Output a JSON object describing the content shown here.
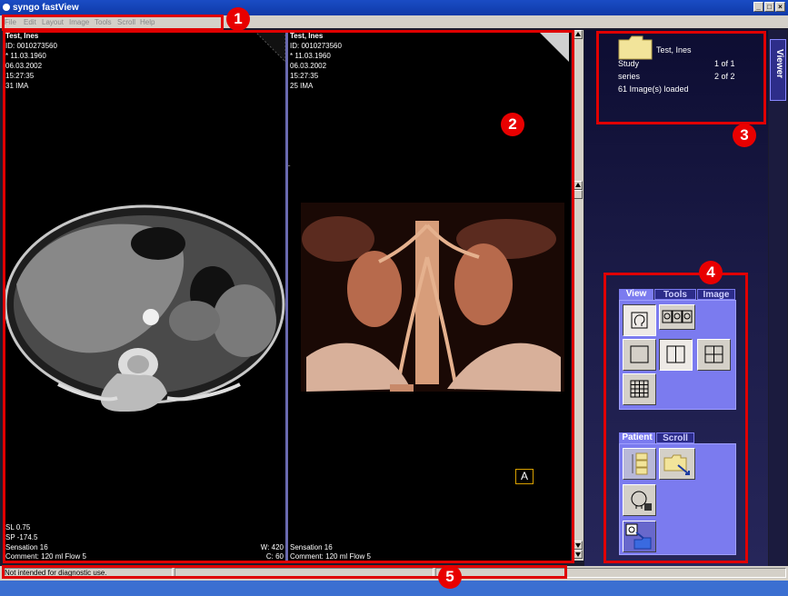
{
  "window": {
    "title": "syngo fastView",
    "minimize": "_",
    "maximize": "□",
    "close": "×"
  },
  "menu": [
    "File",
    "Edit",
    "Layout",
    "Image",
    "Tools",
    "Scroll",
    "Help"
  ],
  "viewer_left": {
    "patient": "Test, Ines",
    "id": "ID: 0010273560",
    "birth": "* 11.03.1960",
    "date": "06.03.2002",
    "time": "15:27:35",
    "ima": "31 IMA",
    "sl": "SL 0.75",
    "sp": "SP -174.5",
    "scanner": "Sensation 16",
    "comment": "Comment: 120 ml Flow 5",
    "w": "W: 420",
    "c": "C: 60"
  },
  "viewer_right": {
    "patient": "Test, Ines",
    "id": "ID: 0010273560",
    "birth": "* 11.03.1960",
    "date": "06.03.2002",
    "time": "15:27:35",
    "ima": "25 IMA",
    "scanner": "Sensation 16",
    "comment": "Comment: 120 ml Flow 5",
    "orientation_marker": "A",
    "side_marker": "L"
  },
  "side_tab": "Viewer",
  "info_panel": {
    "patient": "Test, Ines",
    "study_label": "Study",
    "study_value": "1 of 1",
    "series_label": "series",
    "series_value": "2 of 2",
    "loaded": "61 Image(s) loaded"
  },
  "tool_tabs_1": [
    "View",
    "Tools",
    "Image"
  ],
  "tool_tabs_2": [
    "Patient",
    "Scroll"
  ],
  "status": {
    "message": "Not intended for diagnostic use."
  },
  "annotations": [
    "1",
    "2",
    "3",
    "4",
    "5"
  ],
  "colors": {
    "annotation": "#e00000",
    "panel_accent": "#7b7bef",
    "titlebar": "#1a4cc4"
  }
}
